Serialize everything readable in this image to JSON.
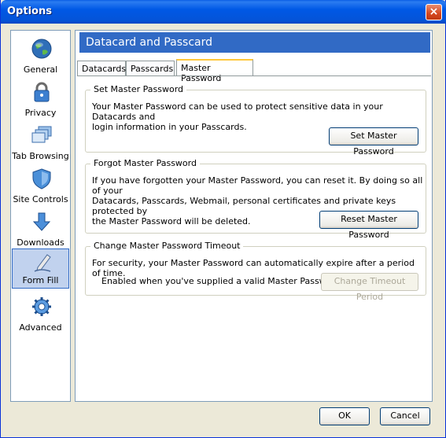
{
  "window": {
    "title": "Options",
    "close_glyph": "×"
  },
  "sidebar": {
    "items": [
      {
        "label": "General",
        "icon": "globe-icon"
      },
      {
        "label": "Privacy",
        "icon": "lock-icon"
      },
      {
        "label": "Tab Browsing",
        "icon": "tabs-icon"
      },
      {
        "label": "Site Controls",
        "icon": "shield-icon"
      },
      {
        "label": "Downloads",
        "icon": "download-arrow-icon"
      },
      {
        "label": "Form Fill",
        "icon": "pen-icon",
        "selected": true
      },
      {
        "label": "Advanced",
        "icon": "gear-icon"
      }
    ]
  },
  "panel": {
    "header": "Datacard and Passcard",
    "tabs": [
      "Datacards",
      "Passcards",
      "Master Password"
    ],
    "active_tab": "Master Password",
    "set_group": {
      "title": "Set Master Password",
      "text_line1": "Your Master Password can be used to protect sensitive data in your Datacards and",
      "text_line2": "login information in your Passcards.",
      "button": "Set Master Password"
    },
    "forgot_group": {
      "title": "Forgot Master Password",
      "text_line1": "If you have forgotten your Master Password, you can reset it. By doing so all of your",
      "text_line2": "Datacards, Passcards, Webmail, personal certificates and private keys protected by",
      "text_line3": "the Master Password will be deleted.",
      "button": "Reset Master Password"
    },
    "timeout_group": {
      "title": "Change Master Password Timeout",
      "text": "For security, your Master Password can automatically expire after a period of time.",
      "enabled_label": "Enabled when you've supplied a valid Master Password:",
      "button": "Change Timeout Period"
    }
  },
  "footer": {
    "ok": "OK",
    "cancel": "Cancel"
  },
  "colors": {
    "title_bar": "#0058e6",
    "header_bar": "#316ac5",
    "selected_item": "#c1d2ee",
    "tab_accent": "#ffc83c"
  }
}
